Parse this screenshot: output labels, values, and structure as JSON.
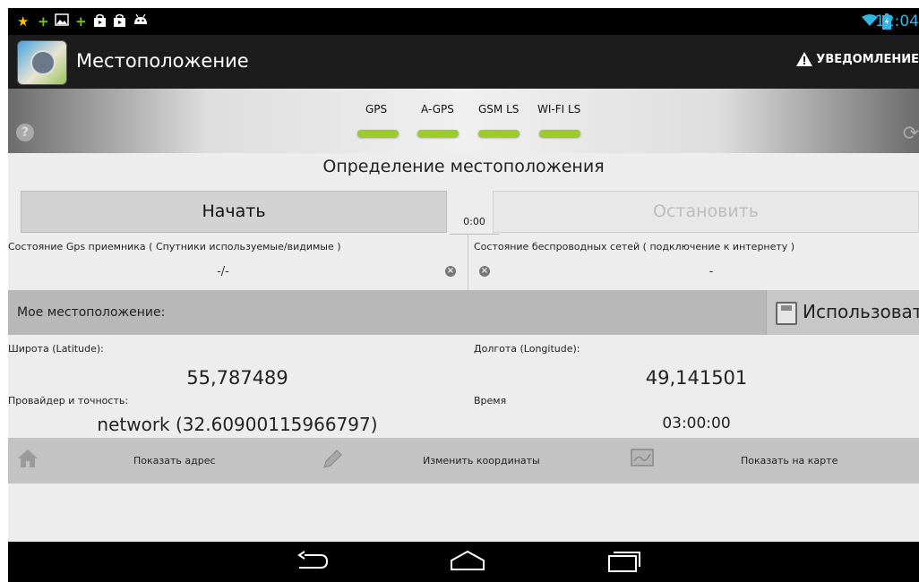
{
  "status_bar": {
    "notification_icons": [
      "star-icon",
      "plus-icon",
      "image-icon",
      "plus-icon",
      "store-bag-icon",
      "store-bag-icon",
      "android-icon"
    ],
    "time": "12:04"
  },
  "action_bar": {
    "title": "Местоположение",
    "notify_label": "УВЕДОМЛЕНИЕ"
  },
  "providers": [
    {
      "label": "GPS",
      "indicator_color": "#9ccc2a"
    },
    {
      "label": "A-GPS",
      "indicator_color": "#9ccc2a"
    },
    {
      "label": "GSM LS",
      "indicator_color": "#9ccc2a"
    },
    {
      "label": "WI-FI LS",
      "indicator_color": "#9ccc2a"
    }
  ],
  "location": {
    "section_title": "Определение местоположения",
    "start_label": "Начать",
    "stop_label": "Остановить",
    "timer": "0:00",
    "gps_status_label": "Состояние Gps приемника ( Спутники используемые/видимые )",
    "gps_status_value": "-/-",
    "net_status_label": "Состояние беспроводных сетей ( подключение к интернету )",
    "net_status_value": "-"
  },
  "my_location": {
    "label": "Мое местоположение:",
    "use_label": "Использовать"
  },
  "coords": {
    "latitude_label": "Широта (Latitude):",
    "latitude": "55,787489",
    "longitude_label": "Долгота (Longitude):",
    "longitude": "49,141501",
    "provider_label": "Провайдер и точность:",
    "provider_value": "network (32.60900115966797)",
    "time_label": "Время",
    "time_value": "03:00:00"
  },
  "toolbar": {
    "show_address": "Показать адрес",
    "edit_coords": "Изменить координаты",
    "show_map": "Показать на карте"
  },
  "colors": {
    "accent": "#33b5e5",
    "indicator": "#9ccc2a",
    "actionbar": "#1c1c1c"
  }
}
